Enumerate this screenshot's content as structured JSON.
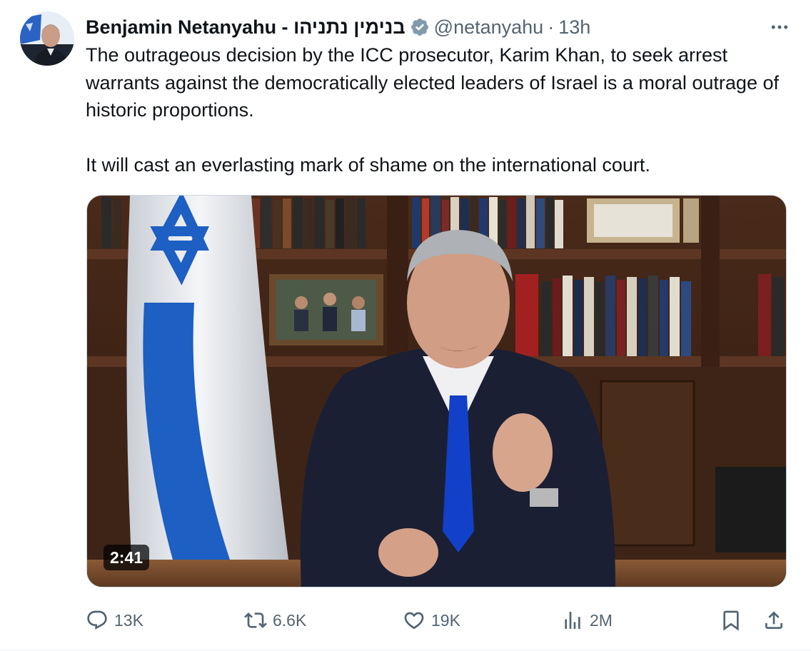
{
  "author": {
    "display_name": "Benjamin Netanyahu - בנימין נתניהו",
    "handle": "@netanyahu",
    "separator": "·",
    "time": "13h",
    "verified": true
  },
  "tweet": {
    "paragraph_1": "The outrageous decision by the ICC prosecutor, Karim Khan, to seek arrest warrants against the democratically elected leaders of Israel is a moral outrage of historic proportions.",
    "paragraph_2": "It will cast an everlasting mark of shame on the international court."
  },
  "media": {
    "duration": "2:41"
  },
  "actions": {
    "replies": "13K",
    "reposts": "6.6K",
    "likes": "19K",
    "views": "2M"
  },
  "colors": {
    "text": "#0f1419",
    "secondary": "#536471",
    "verified": "#829aab",
    "flag_blue": "#1d5fc2"
  },
  "icons": [
    "more-icon",
    "verified-badge-icon",
    "reply-icon",
    "repost-icon",
    "like-icon",
    "views-icon",
    "bookmark-icon",
    "share-icon"
  ]
}
